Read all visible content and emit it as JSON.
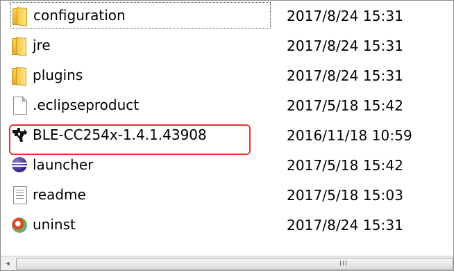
{
  "files": [
    {
      "icon": "folder-icon",
      "name": "configuration",
      "modified": "2017/8/24 15:31"
    },
    {
      "icon": "folder-icon",
      "name": "jre",
      "modified": "2017/8/24 15:31"
    },
    {
      "icon": "folder-icon",
      "name": "plugins",
      "modified": "2017/8/24 15:31"
    },
    {
      "icon": "file-icon",
      "name": ".eclipseproduct",
      "modified": "2017/5/18 15:42"
    },
    {
      "icon": "ti-logo-icon",
      "name": "BLE-CC254x-1.4.1.43908",
      "modified": "2016/11/18 10:59"
    },
    {
      "icon": "eclipse-launcher-icon",
      "name": "launcher",
      "modified": "2017/5/18 15:42"
    },
    {
      "icon": "text-document-icon",
      "name": "readme",
      "modified": "2017/5/18 15:03"
    },
    {
      "icon": "uninstall-icon",
      "name": "uninst",
      "modified": "2017/8/24 15:31"
    }
  ],
  "scrollbar": {
    "left_arrow": "◂",
    "grip": "III"
  },
  "colors": {
    "highlight": "#e0362f",
    "folder": "#f3c640"
  }
}
